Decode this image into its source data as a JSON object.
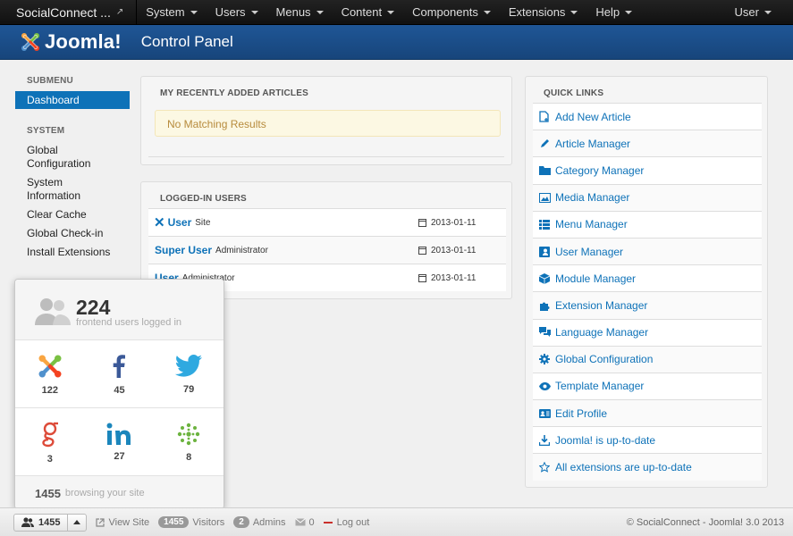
{
  "navbar": {
    "brand": "SocialConnect ...",
    "items": [
      "System",
      "Users",
      "Menus",
      "Content",
      "Components",
      "Extensions",
      "Help"
    ],
    "user": "User"
  },
  "header": {
    "logo_text": "Joomla!",
    "title": "Control Panel"
  },
  "submenu": {
    "heading": "SUBMENU",
    "active": "Dashboard",
    "system_heading": "SYSTEM",
    "links": [
      "Global Configuration",
      "System Information",
      "Clear Cache",
      "Global Check-in",
      "Install Extensions"
    ]
  },
  "recent_articles": {
    "heading": "MY RECENTLY ADDED ARTICLES",
    "empty": "No Matching Results"
  },
  "logged_in": {
    "heading": "LOGGED-IN USERS",
    "rows": [
      {
        "name": "User",
        "role": "Site",
        "date": "2013-01-11"
      },
      {
        "name": "Super User",
        "role": "Administrator",
        "date": "2013-01-11"
      },
      {
        "name": "User",
        "role": "Administrator",
        "date": "2013-01-11"
      }
    ]
  },
  "quick_links": {
    "heading": "QUICK LINKS",
    "items": [
      {
        "label": "Add New Article",
        "icon": "new-article-icon"
      },
      {
        "label": "Article Manager",
        "icon": "pencil-icon"
      },
      {
        "label": "Category Manager",
        "icon": "folder-icon"
      },
      {
        "label": "Media Manager",
        "icon": "image-icon"
      },
      {
        "label": "Menu Manager",
        "icon": "list-icon"
      },
      {
        "label": "User Manager",
        "icon": "user-icon"
      },
      {
        "label": "Module Manager",
        "icon": "cube-icon"
      },
      {
        "label": "Extension Manager",
        "icon": "puzzle-icon"
      },
      {
        "label": "Language Manager",
        "icon": "comments-icon"
      },
      {
        "label": "Global Configuration",
        "icon": "gear-icon"
      },
      {
        "label": "Template Manager",
        "icon": "eye-icon"
      },
      {
        "label": "Edit Profile",
        "icon": "profile-card-icon"
      },
      {
        "label": "Joomla! is up-to-date",
        "icon": "download-icon"
      },
      {
        "label": "All extensions are up-to-date",
        "icon": "star-icon"
      }
    ]
  },
  "social": {
    "count": "224",
    "label": "frontend users logged in",
    "networks": [
      {
        "icon": "joomla-icon",
        "count": "122"
      },
      {
        "icon": "facebook-icon",
        "count": "45"
      },
      {
        "icon": "twitter-icon",
        "count": "79"
      },
      {
        "icon": "google-icon",
        "count": "3"
      },
      {
        "icon": "linkedin-icon",
        "count": "27"
      },
      {
        "icon": "network-icon",
        "count": "8"
      }
    ],
    "browsing_count": "1455",
    "browsing_label": "browsing your site"
  },
  "statusbar": {
    "users_count": "1455",
    "view_site": "View Site",
    "visitors_count": "1455",
    "visitors_label": "Visitors",
    "admins_count": "2",
    "admins_label": "Admins",
    "messages_count": "0",
    "logout": "Log out",
    "copyright": "© SocialConnect - Joomla! 3.0 2013"
  },
  "colors": {
    "accent": "#0e72b8",
    "header": "#1f5696",
    "warning_bg": "#fcf8e3",
    "logout": "#c9302c"
  }
}
